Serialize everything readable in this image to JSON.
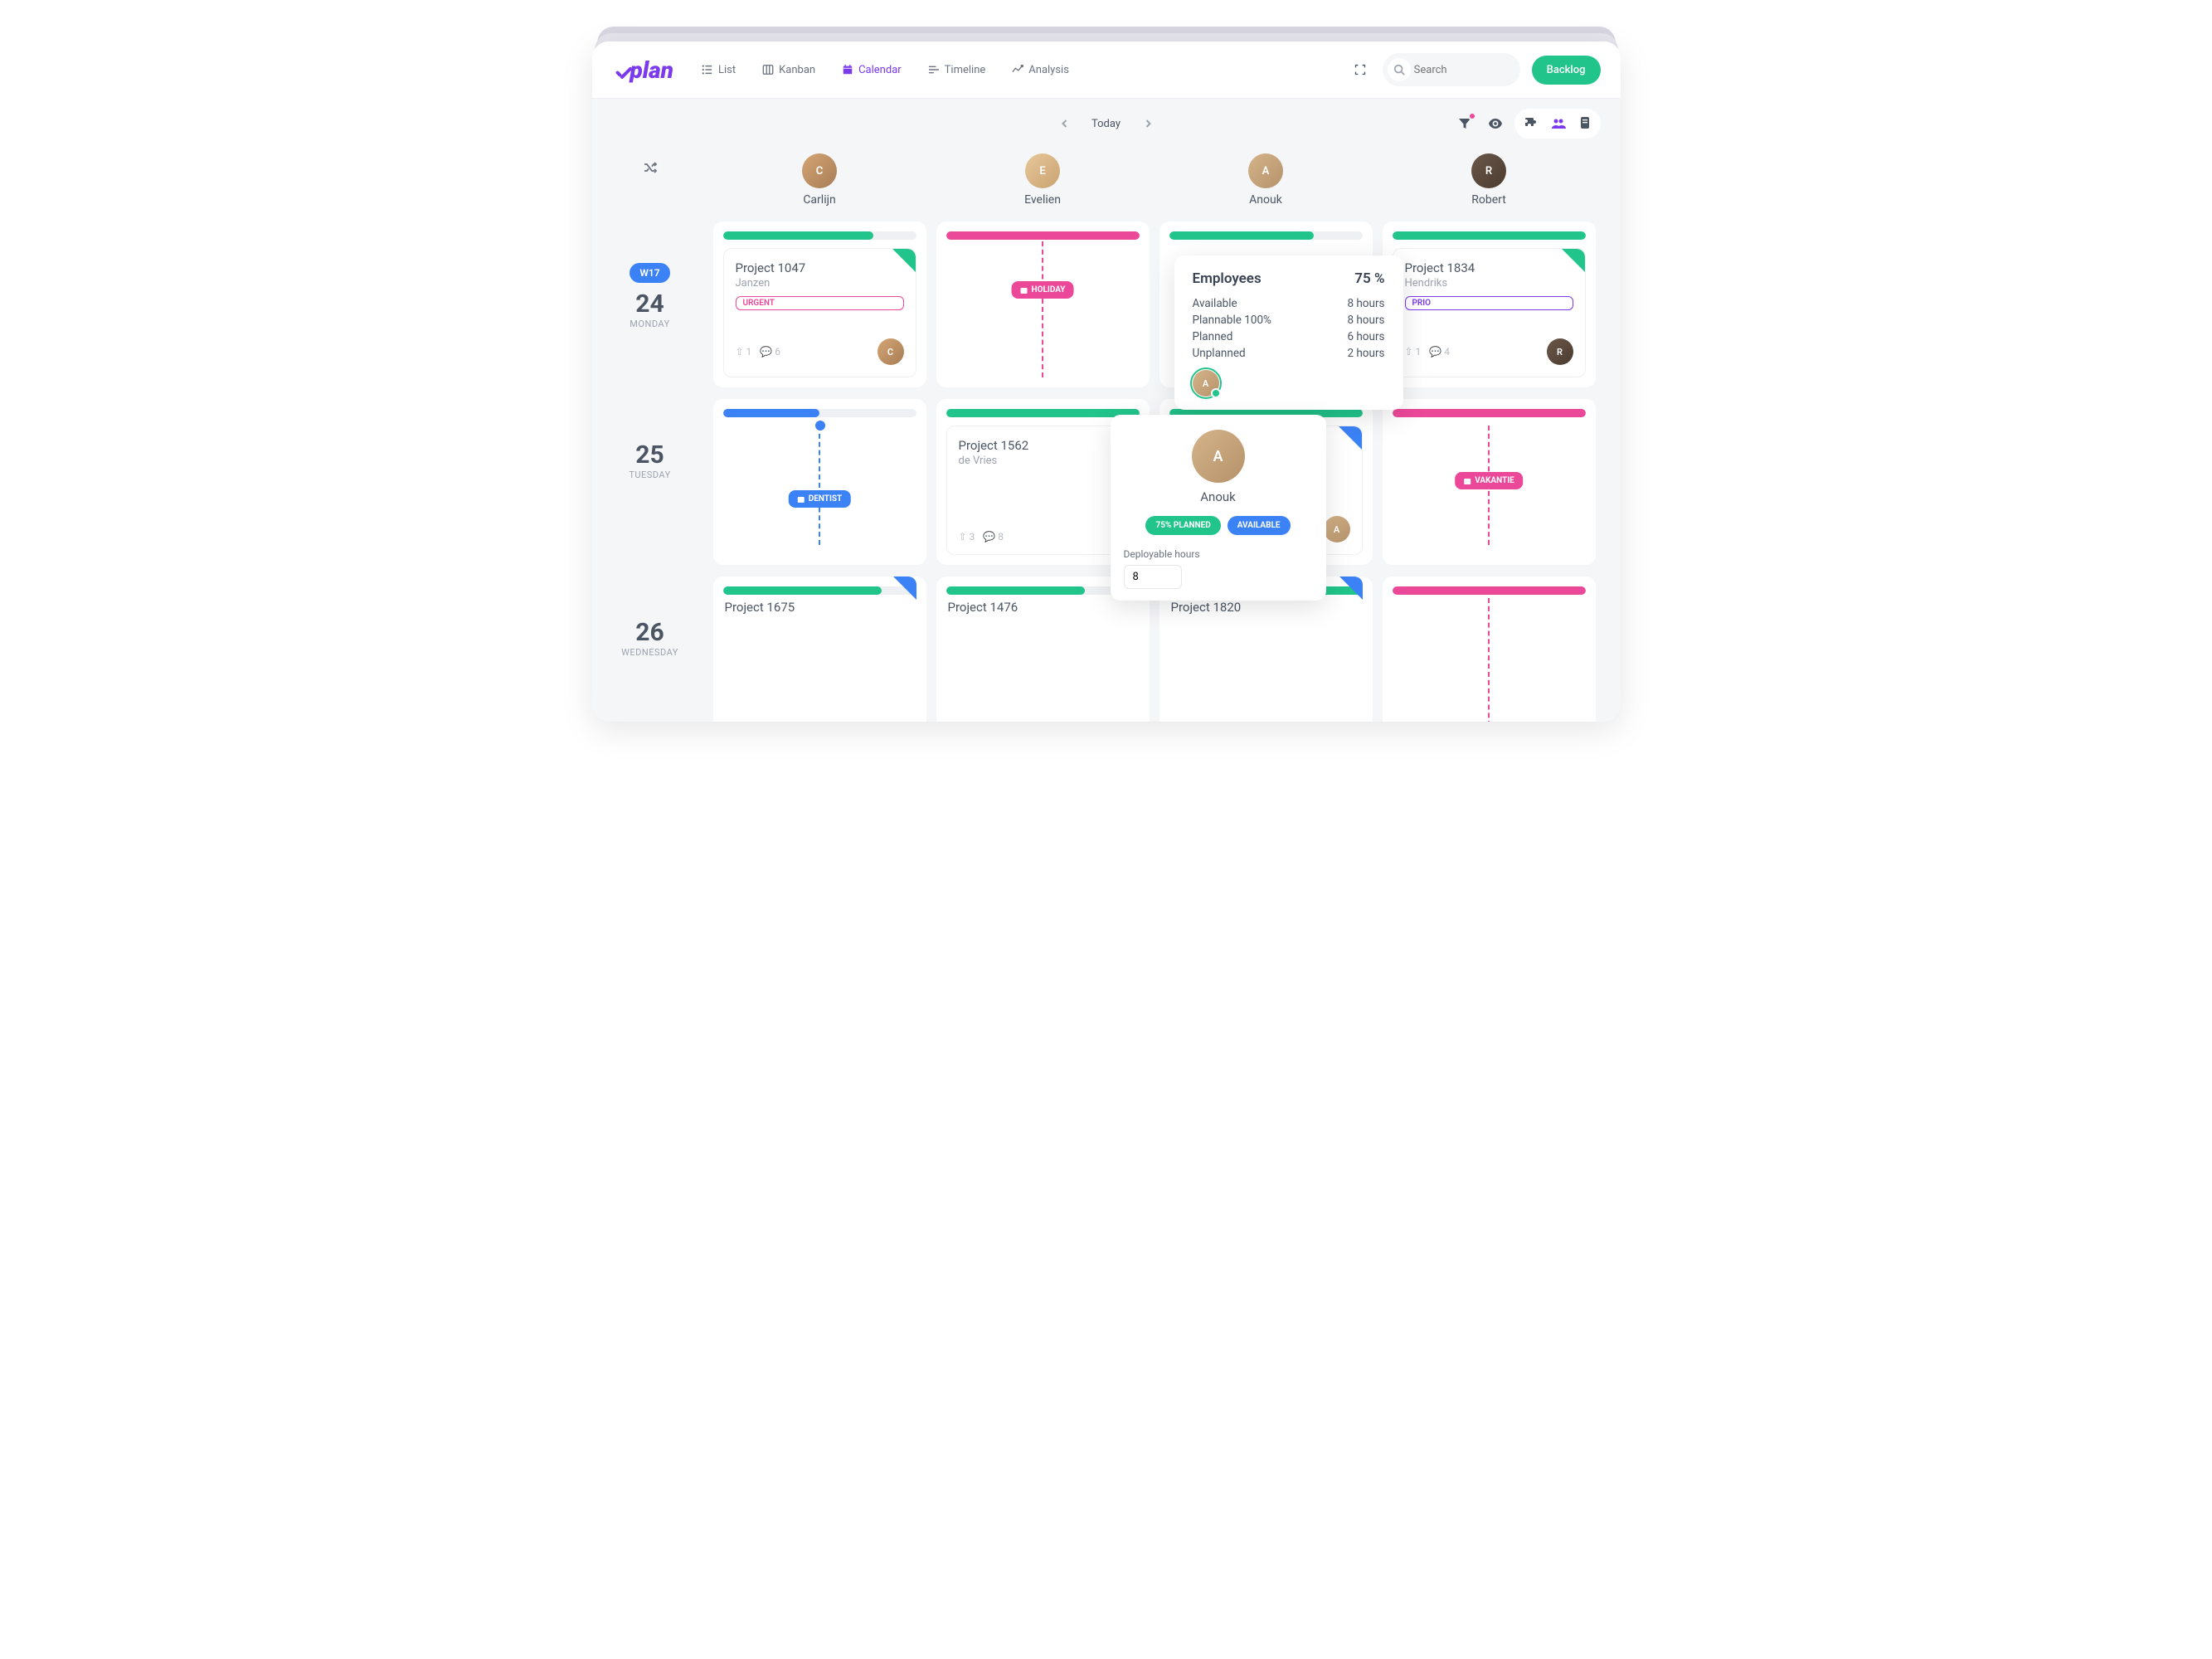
{
  "app_name": "plan",
  "nav": {
    "list": "List",
    "kanban": "Kanban",
    "calendar": "Calendar",
    "timeline": "Timeline",
    "analysis": "Analysis"
  },
  "search_placeholder": "Search",
  "backlog": "Backlog",
  "today": "Today",
  "week_badge": "W17",
  "days": [
    {
      "num": "24",
      "name": "MONDAY"
    },
    {
      "num": "25",
      "name": "TUESDAY"
    },
    {
      "num": "26",
      "name": "WEDNESDAY"
    }
  ],
  "people": [
    "Carlijn",
    "Evelien",
    "Anouk",
    "Robert"
  ],
  "cards": {
    "c_1047": {
      "title": "Project 1047",
      "sub": "Janzen",
      "tag": "URGENT",
      "up": "1",
      "chat": "6"
    },
    "c_1834": {
      "title": "Project 1834",
      "sub": "Hendriks",
      "tag": "PRIO",
      "up": "1",
      "chat": "4"
    },
    "c_1562": {
      "title": "Project 1562",
      "sub": "de Vries",
      "up": "3",
      "chat": "8"
    },
    "c_1675": {
      "title": "Project 1675"
    },
    "c_1476": {
      "title": "Project 1476"
    },
    "c_1820": {
      "title": "Project 1820"
    }
  },
  "events": {
    "holiday": "HOLIDAY",
    "dentist": "DENTIST",
    "vakantie": "VAKANTIE"
  },
  "emp_popup": {
    "title": "Employees",
    "pct": "75 %",
    "rows": [
      {
        "l": "Available",
        "v": "8 hours"
      },
      {
        "l": "Plannable 100%",
        "v": "8 hours"
      },
      {
        "l": "Planned",
        "v": "6 hours"
      },
      {
        "l": "Unplanned",
        "v": "2 hours"
      }
    ]
  },
  "anouk_popup": {
    "name": "Anouk",
    "planned_pill": "75% PLANNED",
    "avail_pill": "AVAILABLE",
    "dep_label": "Deployable hours",
    "dep_value": "8"
  }
}
